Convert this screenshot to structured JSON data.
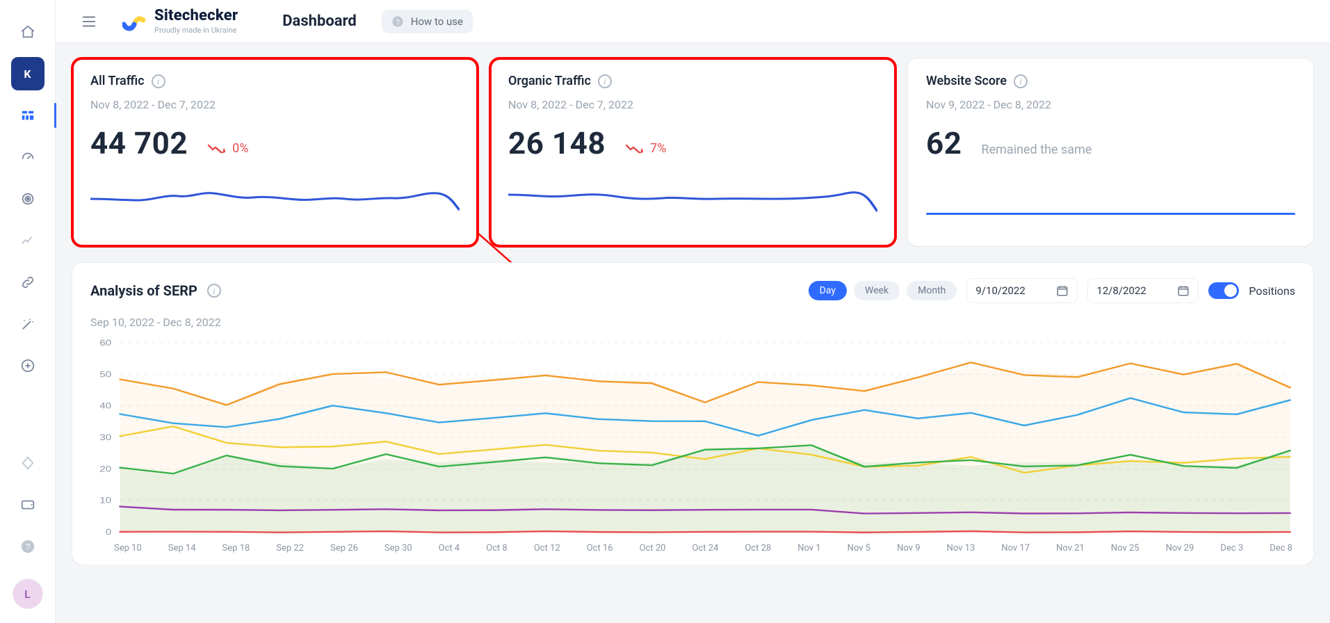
{
  "brand": {
    "title": "Sitechecker",
    "subtitle": "Proudly made in Ukraine"
  },
  "top": {
    "page_title": "Dashboard",
    "how_to_use": "How to use"
  },
  "sidebar": {
    "k_badge": "K",
    "avatar_initial": "L"
  },
  "cards": {
    "all_traffic": {
      "title": "All Traffic",
      "date_range": "Nov 8, 2022 - Dec 7, 2022",
      "value": "44 702",
      "delta": "0%"
    },
    "organic_traffic": {
      "title": "Organic Traffic",
      "date_range": "Nov 8, 2022 - Dec 7, 2022",
      "value": "26 148",
      "delta": "7%"
    },
    "website_score": {
      "title": "Website Score",
      "date_range": "Nov 9, 2022 - Dec 8, 2022",
      "value": "62",
      "status": "Remained the same"
    }
  },
  "serp": {
    "title": "Analysis of SERP",
    "date_range": "Sep 10, 2022 - Dec 8, 2022",
    "seg": {
      "day": "Day",
      "week": "Week",
      "month": "Month"
    },
    "date_start": "9/10/2022",
    "date_end": "12/8/2022",
    "positions_label": "Positions",
    "x_ticks": [
      "Sep 10",
      "Sep 14",
      "Sep 18",
      "Sep 22",
      "Sep 26",
      "Sep 30",
      "Oct 4",
      "Oct 8",
      "Oct 12",
      "Oct 16",
      "Oct 20",
      "Oct 24",
      "Oct 28",
      "Nov 1",
      "Nov 5",
      "Nov 9",
      "Nov 13",
      "Nov 17",
      "Nov 21",
      "Nov 25",
      "Nov 29",
      "Dec 3",
      "Dec 8"
    ],
    "y_ticks": [
      "60",
      "50",
      "40",
      "30",
      "20",
      "10",
      "0"
    ]
  },
  "chart_data": [
    {
      "type": "line",
      "title": "All Traffic sparkline",
      "x": [
        0,
        1,
        2,
        3,
        4,
        5,
        6,
        7,
        8,
        9,
        10,
        11,
        12,
        13,
        14,
        15,
        16,
        17,
        18,
        19,
        20,
        21,
        22,
        23,
        24,
        25,
        26,
        27,
        28,
        29
      ],
      "values": [
        1500,
        1505,
        1495,
        1490,
        1530,
        1560,
        1540,
        1510,
        1500,
        1520,
        1515,
        1500,
        1505,
        1495,
        1520,
        1530,
        1510,
        1500,
        1505,
        1502,
        1490,
        1500,
        1510,
        1520,
        1540,
        1560,
        1590,
        1610,
        1600,
        1430
      ]
    },
    {
      "type": "line",
      "title": "Organic Traffic sparkline",
      "x": [
        0,
        1,
        2,
        3,
        4,
        5,
        6,
        7,
        8,
        9,
        10,
        11,
        12,
        13,
        14,
        15,
        16,
        17,
        18,
        19,
        20,
        21,
        22,
        23,
        24,
        25,
        26,
        27,
        28,
        29
      ],
      "values": [
        900,
        905,
        895,
        890,
        910,
        905,
        880,
        870,
        880,
        875,
        870,
        875,
        872,
        870,
        876,
        874,
        872,
        870,
        874,
        876,
        880,
        884,
        886,
        888,
        890,
        900,
        920,
        935,
        910,
        820
      ]
    },
    {
      "type": "line",
      "title": "Website Score sparkline",
      "x": [
        0,
        1
      ],
      "values": [
        62,
        62
      ]
    },
    {
      "type": "line",
      "title": "Analysis of SERP — Positions",
      "xlabel": "",
      "ylabel": "",
      "ylim": [
        0,
        60
      ],
      "categories": [
        "Sep 10",
        "Sep 14",
        "Sep 18",
        "Sep 22",
        "Sep 26",
        "Sep 30",
        "Oct 4",
        "Oct 8",
        "Oct 12",
        "Oct 16",
        "Oct 20",
        "Oct 24",
        "Oct 28",
        "Nov 1",
        "Nov 5",
        "Nov 9",
        "Nov 13",
        "Nov 17",
        "Nov 21",
        "Nov 25",
        "Nov 29",
        "Dec 3",
        "Dec 8"
      ],
      "series": [
        {
          "name": "orange",
          "color": "#f39b2b",
          "values": [
            48,
            45,
            40,
            48,
            50,
            49,
            48,
            49,
            48,
            48,
            48,
            41,
            47,
            46,
            46,
            49,
            52,
            51,
            50,
            52,
            50,
            54,
            46
          ]
        },
        {
          "name": "blue",
          "color": "#3aa7e6",
          "values": [
            37,
            34,
            33,
            37,
            40,
            36,
            36,
            37,
            36,
            36,
            36,
            35,
            30,
            35,
            40,
            36,
            36,
            35,
            38,
            41,
            38,
            38,
            42
          ]
        },
        {
          "name": "yellow",
          "color": "#f2d037",
          "values": [
            30,
            33,
            28,
            28,
            27,
            27,
            26,
            27,
            26,
            26,
            26,
            23,
            26,
            24,
            22,
            21,
            22,
            20,
            22,
            21,
            22,
            24,
            24
          ]
        },
        {
          "name": "green",
          "color": "#38b24a",
          "values": [
            20,
            18,
            24,
            22,
            20,
            23,
            22,
            23,
            22,
            22,
            22,
            26,
            26,
            27,
            22,
            22,
            21,
            22,
            22,
            23,
            21,
            21,
            26
          ]
        },
        {
          "name": "purple",
          "color": "#9b3fb0",
          "values": [
            8,
            7,
            7,
            7,
            7,
            7,
            7,
            7,
            7,
            7,
            7,
            7,
            7,
            7,
            6,
            6,
            6,
            6,
            6,
            6,
            6,
            6,
            6
          ]
        },
        {
          "name": "red",
          "color": "#e94e4e",
          "values": [
            0,
            0,
            0,
            0,
            0,
            0,
            0,
            0,
            0,
            0,
            0,
            0,
            0,
            0,
            0,
            0,
            0,
            0,
            0,
            0,
            0,
            0,
            0
          ]
        }
      ]
    }
  ]
}
